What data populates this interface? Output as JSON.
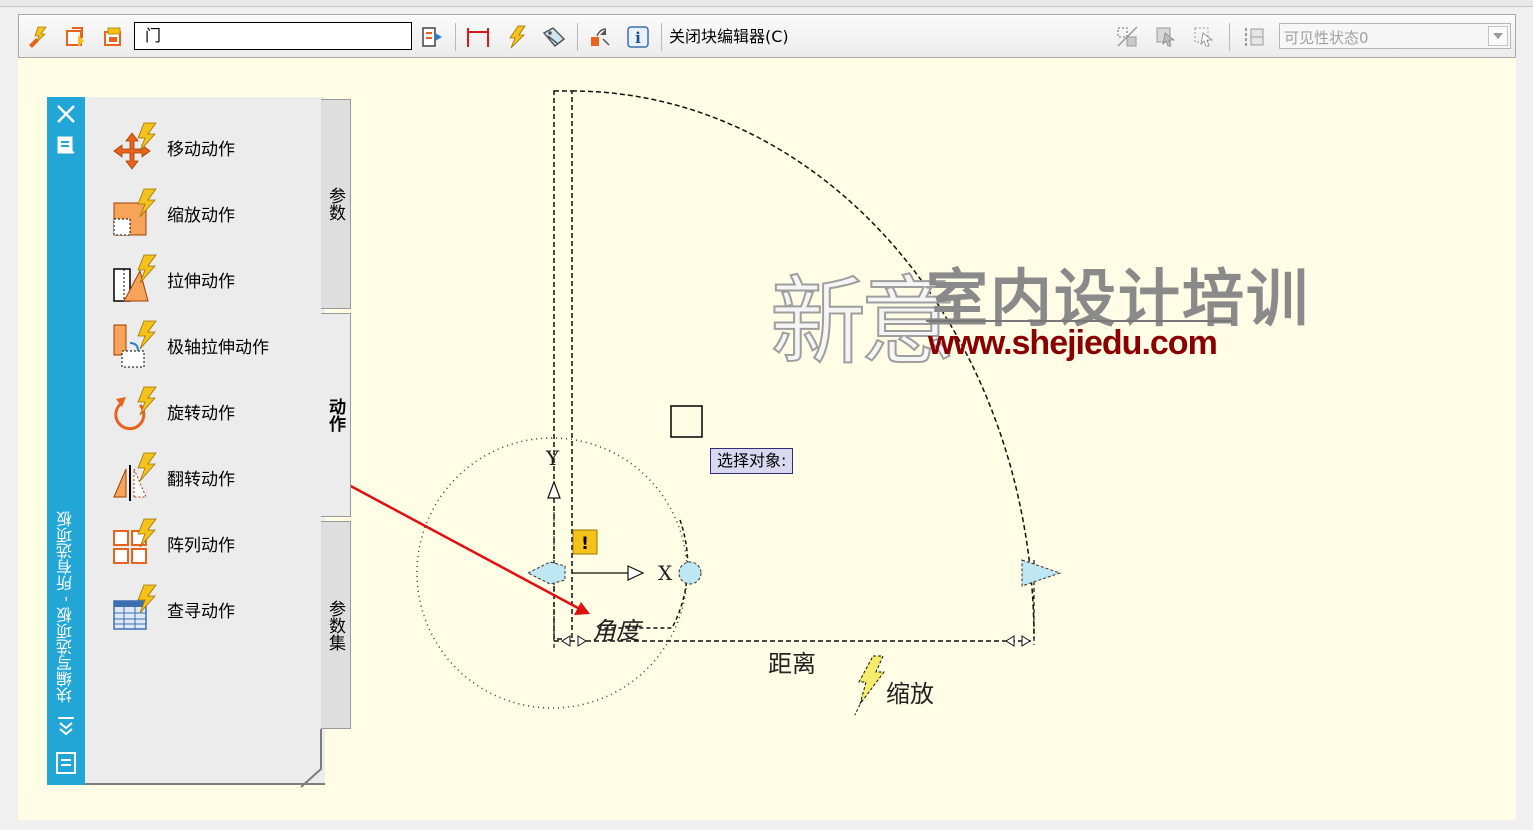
{
  "toolbar": {
    "block_name": "门",
    "close_editor_label": "关闭块编辑器(C)",
    "visibility_state": "可见性状态0"
  },
  "palette": {
    "title": "块编写选项板 - 所有选项板",
    "items": [
      {
        "label": "移动动作",
        "icon": "move-action-icon"
      },
      {
        "label": "缩放动作",
        "icon": "scale-action-icon"
      },
      {
        "label": "拉伸动作",
        "icon": "stretch-action-icon"
      },
      {
        "label": "极轴拉伸动作",
        "icon": "polar-stretch-action-icon"
      },
      {
        "label": "旋转动作",
        "icon": "rotate-action-icon"
      },
      {
        "label": "翻转动作",
        "icon": "flip-action-icon"
      },
      {
        "label": "阵列动作",
        "icon": "array-action-icon"
      },
      {
        "label": "查寻动作",
        "icon": "lookup-action-icon"
      }
    ],
    "tabs": {
      "parameters": "参数",
      "actions": "动作",
      "parameter_sets": "参数集"
    },
    "active_tab": "actions"
  },
  "drawing": {
    "prompt": "选择对象:",
    "angle_label": "角度",
    "distance_label": "距离",
    "scale_label": "缩放",
    "x_label": "X",
    "y_label": "Y"
  },
  "watermark": {
    "chars_outline": "新意",
    "chars_brush": "室内设计培训",
    "url": "www.shejiedu.com"
  },
  "colors": {
    "canvas": "#fffde6",
    "palette_bar": "#22a6d6",
    "annotation_arrow": "#e01010",
    "lightning": "#f4c21b",
    "icon_orange": "#e8631c"
  }
}
